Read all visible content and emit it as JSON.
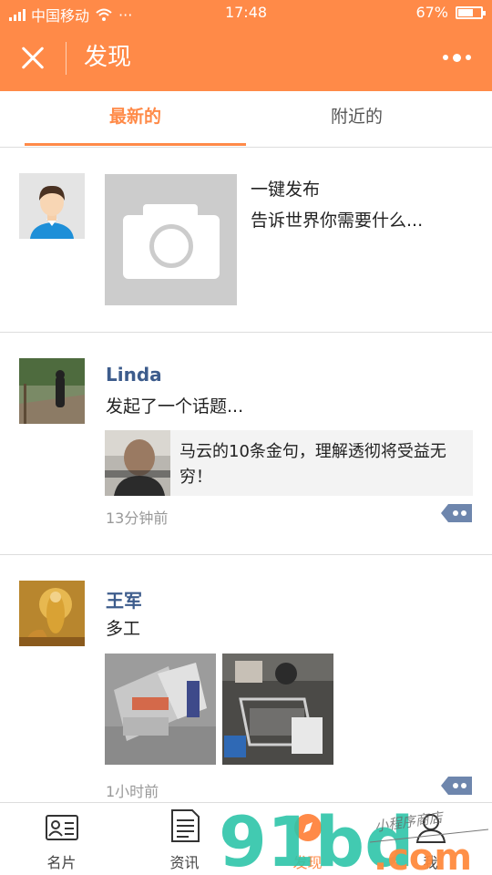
{
  "status_bar": {
    "carrier": "中国移动",
    "more": "···",
    "time": "17:48",
    "battery_text": "67%",
    "battery_level": 0.67
  },
  "title_bar": {
    "title": "发现"
  },
  "tabs": [
    {
      "label": "最新的",
      "active": true
    },
    {
      "label": "附近的",
      "active": false
    }
  ],
  "compose": {
    "line1": "一键发布",
    "line2": "告诉世界你需要什么..."
  },
  "posts": [
    {
      "name": "Linda",
      "text": "发起了一个话题...",
      "share_title": "马云的10条金句，理解透彻将受益无穷！",
      "time": "13分钟前"
    },
    {
      "name": "王军",
      "text": "多工",
      "time": "1小时前"
    }
  ],
  "bottom_nav": [
    {
      "label": "名片",
      "icon": "card-icon"
    },
    {
      "label": "资讯",
      "icon": "document-icon"
    },
    {
      "label": "发现",
      "icon": "compass-icon"
    },
    {
      "label": "我",
      "icon": "person-icon"
    }
  ],
  "watermark": {
    "brand": "91bd",
    "domain": ".com",
    "script": "小程序商店"
  },
  "colors": {
    "accent": "#FF8A48",
    "name_link": "#3D5C8C",
    "watermark_teal": "#2EC4A8",
    "watermark_orange": "#FF8A3D"
  }
}
